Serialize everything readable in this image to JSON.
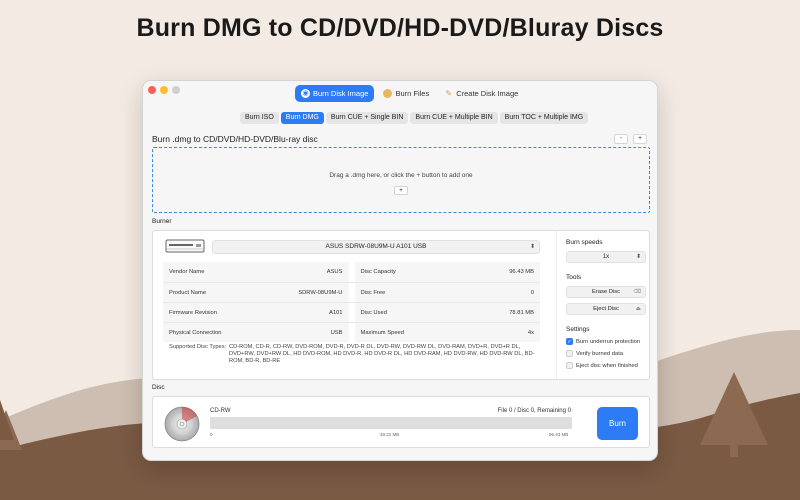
{
  "headline": "Burn DMG to CD/DVD/HD-DVD/Bluray Discs",
  "top_tabs": [
    {
      "label": "Burn Disk Image",
      "icon": "disc-icon",
      "active": true
    },
    {
      "label": "Burn Files",
      "icon": "files-icon",
      "active": false
    },
    {
      "label": "Create Disk Image",
      "icon": "wand-icon",
      "active": false
    }
  ],
  "sub_tabs": [
    {
      "label": "Burn ISO",
      "active": false
    },
    {
      "label": "Burn DMG",
      "active": true
    },
    {
      "label": "Burn CUE + Single BIN",
      "active": false
    },
    {
      "label": "Burn CUE + Multiple BIN",
      "active": false
    },
    {
      "label": "Burn TOC + Multiple IMG",
      "active": false
    }
  ],
  "section": {
    "title": "Burn .dmg to CD/DVD/HD-DVD/Blu-ray disc",
    "minus_label": "-",
    "plus_label": "+"
  },
  "dropzone": {
    "text": "Drag a .dmg here, or click the + button to add one",
    "add_label": "+"
  },
  "burner": {
    "label": "Burner",
    "device": "ASUS SDRW-08U9M-U A101 USB",
    "info": [
      [
        {
          "k": "Vendor Name",
          "v": "ASUS"
        },
        {
          "k": "Disc Capacity",
          "v": "96.43 MB"
        }
      ],
      [
        {
          "k": "Product Name",
          "v": "SDRW-08U9M-U"
        },
        {
          "k": "Disc Free",
          "v": "0"
        }
      ],
      [
        {
          "k": "Firmware Revision",
          "v": "A101"
        },
        {
          "k": "Disc Used",
          "v": "78.81 MB"
        }
      ],
      [
        {
          "k": "Physical Connection",
          "v": "USB"
        },
        {
          "k": "Maximum Speed",
          "v": "4x"
        }
      ]
    ],
    "supported_label": "Supported Disc Types:",
    "supported_value": "CD-ROM, CD-R, CD-RW, DVD-ROM, DVD-R, DVD-R DL, DVD-RW, DVD-RW DL, DVD-RAM, DVD+R, DVD+R DL, DVD+RW, DVD+RW DL, HD DVD-ROM, HD DVD-R, HD DVD-R DL, HD DVD-RAM, HD DVD-RW, HD DVD-RW DL, BD-ROM, BD-R, BD-RE"
  },
  "side": {
    "speed_label": "Burn speeds",
    "speed_value": "1x",
    "tools_label": "Tools",
    "erase_label": "Erase Disc",
    "eject_label": "Eject Disc",
    "settings_label": "Settings",
    "settings": [
      {
        "label": "Burn underrun protection",
        "checked": true
      },
      {
        "label": "Verify burned data",
        "checked": false
      },
      {
        "label": "Eject disc when finished",
        "checked": false
      }
    ]
  },
  "disc": {
    "label": "Disc",
    "type": "CD-RW",
    "file_info": "File 0 / Disc 0, Remaining 0",
    "progress": 0,
    "ticks": [
      "0",
      "48.22 MB",
      "96.43 MB"
    ],
    "burn_label": "Burn"
  },
  "colors": {
    "accent": "#2e7bf6",
    "background": "#f3ebe3",
    "hills": "#8a6a52"
  }
}
